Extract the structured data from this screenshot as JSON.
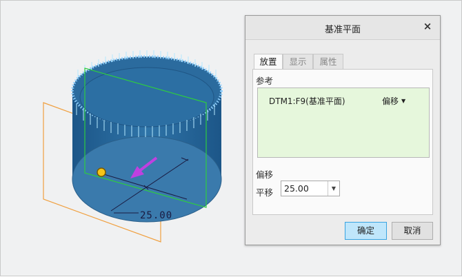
{
  "dialog": {
    "title": "基准平面",
    "close_icon": "close-icon",
    "tabs": [
      {
        "label": "放置",
        "active": true
      },
      {
        "label": "显示",
        "active": false
      },
      {
        "label": "属性",
        "active": false
      }
    ],
    "references": {
      "label": "参考",
      "items": [
        {
          "name": "DTM1:F9(基准平面)",
          "constraint": "偏移"
        }
      ]
    },
    "offset": {
      "section_label": "偏移",
      "field_label": "平移",
      "value": "25.00"
    },
    "buttons": {
      "ok": "确定",
      "cancel": "取消"
    }
  },
  "viewport": {
    "dimension_value": "25.00",
    "colors": {
      "background": "#f0f1f2",
      "solid": "#2e6e9e",
      "plane_green": "#2ecc40",
      "plane_orange": "#f0a040",
      "drag_arrow": "#c040e0",
      "knurl": "#9fe0ff"
    }
  }
}
